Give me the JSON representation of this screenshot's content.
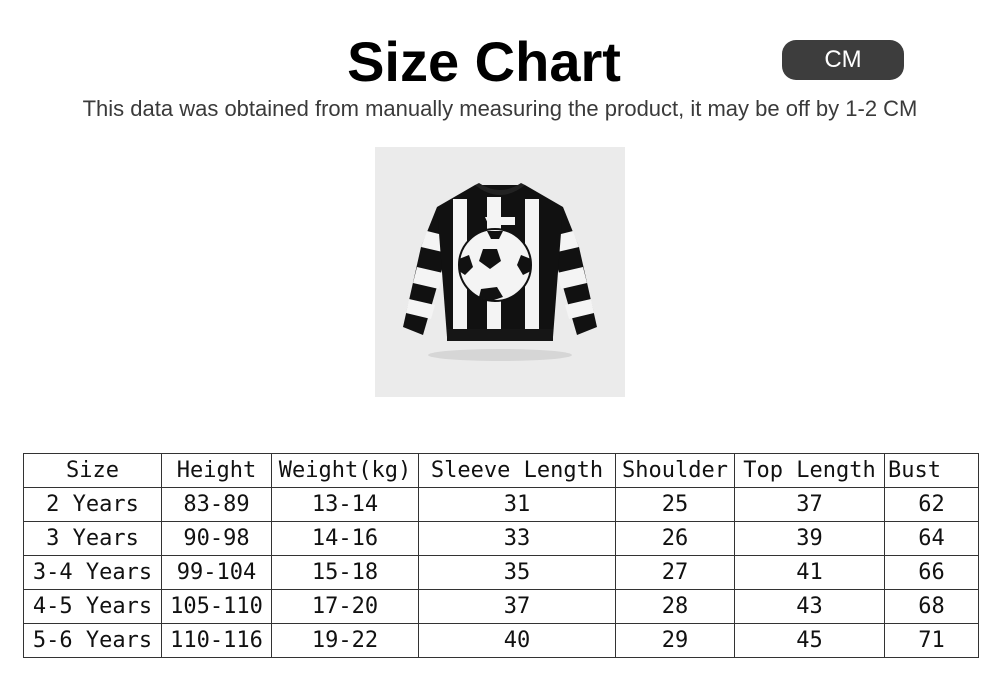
{
  "header": {
    "title": "Size Chart",
    "unit_label": "CM",
    "subtitle": "This data was obtained from manually measuring the product, it may be off by 1-2 CM"
  },
  "product": {
    "image": "black-and-white-striped-knit-sweater-with-soccer-ball-graphic"
  },
  "size_table": {
    "columns": [
      "Size",
      "Height",
      "Weight(kg)",
      "Sleeve Length",
      "Shoulder",
      "Top Length",
      "Bust"
    ],
    "rows": [
      [
        "2 Years",
        "83-89",
        "13-14",
        "31",
        "25",
        "37",
        "62"
      ],
      [
        "3 Years",
        "90-98",
        "14-16",
        "33",
        "26",
        "39",
        "64"
      ],
      [
        "3-4 Years",
        "99-104",
        "15-18",
        "35",
        "27",
        "41",
        "66"
      ],
      [
        "4-5 Years",
        "105-110",
        "17-20",
        "37",
        "28",
        "43",
        "68"
      ],
      [
        "5-6 Years",
        "110-116",
        "19-22",
        "40",
        "29",
        "45",
        "71"
      ]
    ]
  }
}
